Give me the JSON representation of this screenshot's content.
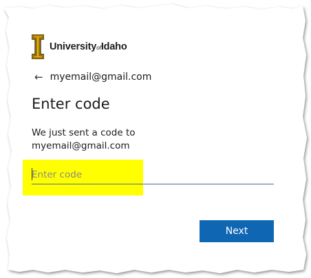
{
  "brand": {
    "name_main": "University",
    "name_of": "of",
    "name_end": "Idaho",
    "logo_color": "#f1b300"
  },
  "back": {
    "icon": "arrow-left-icon",
    "email": "myemail@gmail.com"
  },
  "page": {
    "title": "Enter code",
    "description_line1": "We just sent a code to",
    "description_line2": "myemail@gmail.com"
  },
  "code_input": {
    "placeholder": "Enter code",
    "value": ""
  },
  "actions": {
    "next_label": "Next"
  },
  "colors": {
    "primary": "#0f67b4",
    "highlight": "#ffff00"
  }
}
